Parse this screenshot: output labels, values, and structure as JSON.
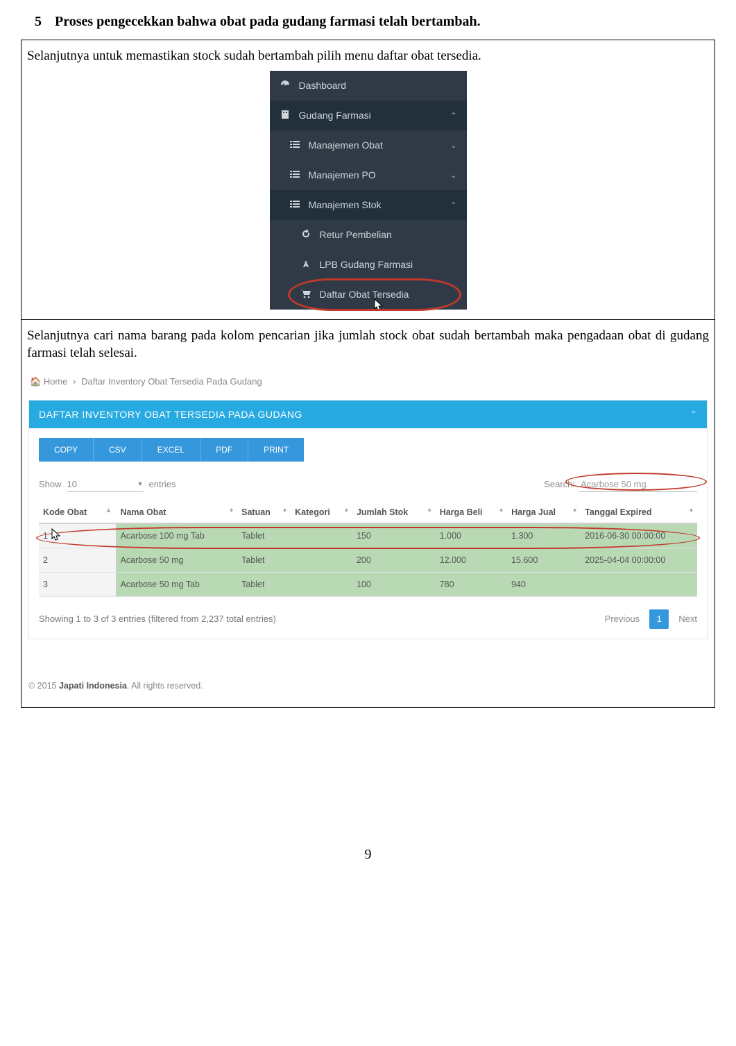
{
  "heading": {
    "number": "5",
    "text": "Proses pengecekkan bahwa obat pada gudang farmasi telah bertambah."
  },
  "cell1": {
    "instruction": "Selanjutnya untuk memastikan stock sudah bertambah pilih menu daftar obat tersedia.",
    "sidebar": {
      "dashboard": "Dashboard",
      "gudang": "Gudang Farmasi",
      "man_obat": "Manajemen Obat",
      "man_po": "Manajemen PO",
      "man_stok": "Manajemen Stok",
      "retur": "Retur Pembelian",
      "lpb": "LPB Gudang Farmasi",
      "daftar": "Daftar Obat Tersedia"
    }
  },
  "cell2": {
    "instruction": "Selanjutnya cari nama barang pada kolom pencarian jika jumlah stock obat sudah bertambah maka pengadaan obat di gudang farmasi telah selesai.",
    "crumb_home": "Home",
    "crumb_page": "Daftar Inventory Obat Tersedia Pada Gudang",
    "panel_title": "DAFTAR INVENTORY OBAT TERSEDIA PADA GUDANG",
    "buttons": {
      "copy": "COPY",
      "csv": "CSV",
      "excel": "EXCEL",
      "pdf": "PDF",
      "print": "PRINT"
    },
    "show_label": "Show",
    "show_value": "10",
    "entries_label": "entries",
    "search_label": "Search:",
    "search_value": "Acarbose 50 mg",
    "cols": {
      "kode": "Kode Obat",
      "nama": "Nama Obat",
      "satuan": "Satuan",
      "kategori": "Kategori",
      "jumlah": "Jumlah Stok",
      "hbeli": "Harga Beli",
      "hjual": "Harga Jual",
      "exp": "Tanggal Expired"
    },
    "rows": [
      {
        "kode": "1",
        "nama": "Acarbose 100 mg Tab",
        "satuan": "Tablet",
        "kategori": "",
        "jumlah": "150",
        "hbeli": "1.000",
        "hjual": "1.300",
        "exp": "2016-06-30 00:00:00"
      },
      {
        "kode": "2",
        "nama": "Acarbose 50 mg",
        "satuan": "Tablet",
        "kategori": "",
        "jumlah": "200",
        "hbeli": "12.000",
        "hjual": "15.600",
        "exp": "2025-04-04 00:00:00"
      },
      {
        "kode": "3",
        "nama": "Acarbose 50 mg Tab",
        "satuan": "Tablet",
        "kategori": "",
        "jumlah": "100",
        "hbeli": "780",
        "hjual": "940",
        "exp": ""
      }
    ],
    "info": "Showing 1 to 3 of 3 entries (filtered from 2,237 total entries)",
    "pager": {
      "prev": "Previous",
      "cur": "1",
      "next": "Next"
    },
    "copyright_pre": "© 2015 ",
    "copyright_bold": "Japati Indonesia",
    "copyright_post": ". All rights reserved."
  },
  "page_number": "9"
}
